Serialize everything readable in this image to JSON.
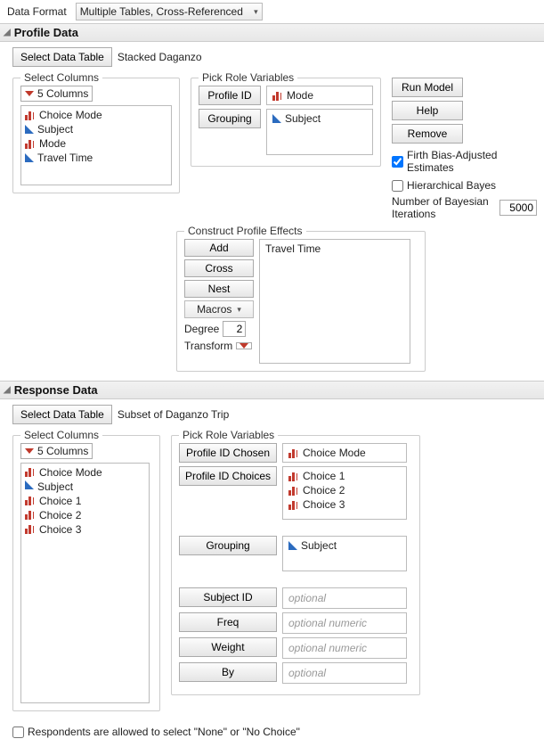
{
  "header": {
    "data_format_label": "Data Format",
    "data_format_value": "Multiple Tables, Cross-Referenced"
  },
  "profile": {
    "title": "Profile Data",
    "select_table_btn": "Select Data Table",
    "selected_table": "Stacked Daganzo",
    "select_columns_legend": "Select Columns",
    "cols_menu_label": "5 Columns",
    "columns": [
      {
        "name": "Choice Mode",
        "icon": "bars"
      },
      {
        "name": "Subject",
        "icon": "tri"
      },
      {
        "name": "Mode",
        "icon": "bars"
      },
      {
        "name": "Travel Time",
        "icon": "tri"
      }
    ],
    "roles_legend": "Pick Role Variables",
    "profile_id_btn": "Profile ID",
    "profile_id_assigned": "Mode",
    "grouping_btn": "Grouping",
    "grouping_assigned": "Subject",
    "actions": {
      "run": "Run Model",
      "help": "Help",
      "remove": "Remove"
    },
    "firth_label": "Firth Bias-Adjusted Estimates",
    "firth_checked": true,
    "hbayes_label": "Hierarchical Bayes",
    "hbayes_checked": false,
    "bayes_iter_label": "Number of Bayesian Iterations",
    "bayes_iter_value": "5000",
    "effects": {
      "legend": "Construct Profile Effects",
      "add": "Add",
      "cross": "Cross",
      "nest": "Nest",
      "macros": "Macros",
      "degree_label": "Degree",
      "degree_value": "2",
      "transform_label": "Transform",
      "list": [
        "Travel Time"
      ]
    }
  },
  "response": {
    "title": "Response Data",
    "select_table_btn": "Select Data Table",
    "selected_table": "Subset of Daganzo Trip",
    "select_columns_legend": "Select Columns",
    "cols_menu_label": "5 Columns",
    "columns": [
      {
        "name": "Choice Mode",
        "icon": "bars"
      },
      {
        "name": "Subject",
        "icon": "tri"
      },
      {
        "name": "Choice 1",
        "icon": "bars"
      },
      {
        "name": "Choice 2",
        "icon": "bars"
      },
      {
        "name": "Choice 3",
        "icon": "bars"
      }
    ],
    "roles_legend": "Pick Role Variables",
    "chosen_btn": "Profile ID Chosen",
    "chosen_assigned": "Choice Mode",
    "choices_btn": "Profile ID Choices",
    "choices_assigned": [
      "Choice 1",
      "Choice 2",
      "Choice 3"
    ],
    "grouping_btn": "Grouping",
    "grouping_assigned": "Subject",
    "subject_btn": "Subject ID",
    "subject_placeholder": "optional",
    "freq_btn": "Freq",
    "freq_placeholder": "optional numeric",
    "weight_btn": "Weight",
    "weight_placeholder": "optional numeric",
    "by_btn": "By",
    "by_placeholder": "optional"
  },
  "footer": {
    "none_choice_label": "Respondents are allowed to select \"None\" or \"No Choice\"",
    "none_choice_checked": false
  }
}
